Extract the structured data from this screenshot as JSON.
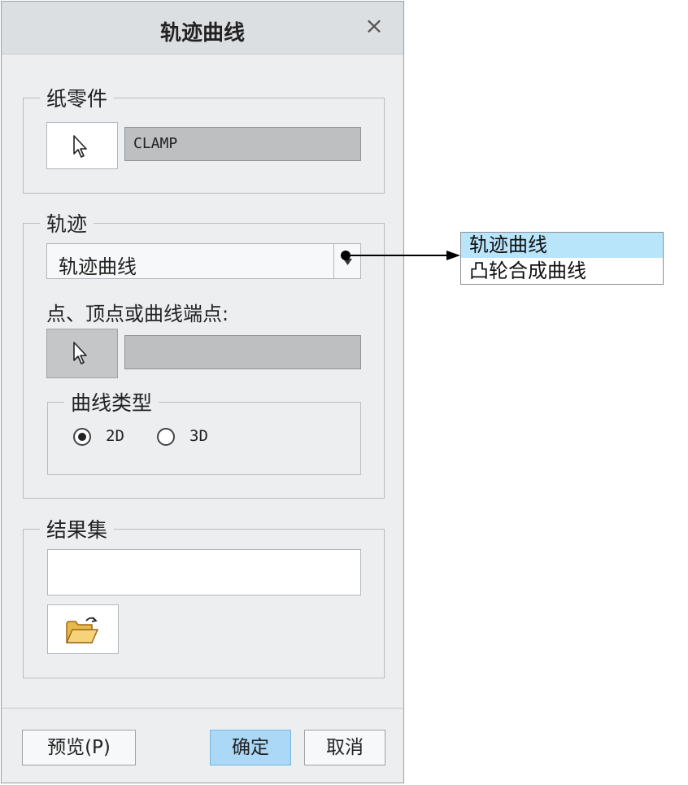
{
  "dialog": {
    "title": "轨迹曲线",
    "close_glyph": "×"
  },
  "sheetmetal_part": {
    "legend": "纸零件",
    "select_icon": "cursor-arrow-icon",
    "value": "CLAMP"
  },
  "trajectory": {
    "legend": "轨迹",
    "combo_value": "轨迹曲线",
    "point_label": "点、顶点或曲线端点:",
    "point_value": "",
    "curve_type": {
      "legend": "曲线类型",
      "options": [
        "2D",
        "3D"
      ],
      "selected": "2D"
    }
  },
  "result_set": {
    "legend": "结果集",
    "value": "",
    "open_icon": "folder-open-icon"
  },
  "footer": {
    "preview_label": "预览(P)",
    "ok_label": "确定",
    "cancel_label": "取消"
  },
  "dropdown": {
    "items": [
      "轨迹曲线",
      "凸轮合成曲线"
    ],
    "selected_index": 0
  },
  "colors": {
    "primary_button": "#aad8f6",
    "dropdown_highlight": "#b9e5fb",
    "dialog_bg": "#eceef0"
  }
}
